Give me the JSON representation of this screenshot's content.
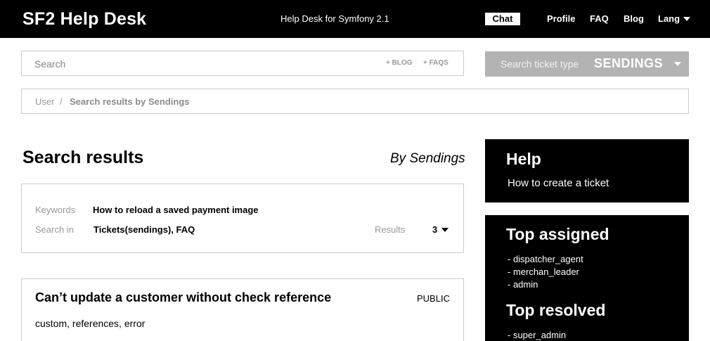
{
  "header": {
    "logo": "SF2 Help Desk",
    "tagline": "Help Desk for Symfony 2.1",
    "chat_label": "Chat",
    "nav": {
      "profile": "Profile",
      "faq": "FAQ",
      "blog": "Blog",
      "lang": "Lang"
    }
  },
  "search": {
    "placeholder": "Search",
    "blog_link": "+ BLOG",
    "faqs_link": "+ FAQS"
  },
  "ticket_type": {
    "label": "Search ticket type",
    "value": "SENDINGS"
  },
  "breadcrumb": {
    "user": "User",
    "separator": "/",
    "current": "Search results by Sendings"
  },
  "main": {
    "title": "Search results",
    "by_label": "By Sendings",
    "info": {
      "keywords_label": "Keywords",
      "keywords_value": "How to reload a saved payment image",
      "search_in_label": "Search in",
      "search_in_value": "Tickets(sendings), FAQ",
      "results_label": "Results",
      "results_value": "3"
    },
    "results": [
      {
        "title": "Can’t update a customer without check reference",
        "badge": "PUBLIC",
        "tags": "custom, references, error"
      }
    ]
  },
  "sidebar": {
    "help": {
      "title": "Help",
      "link": "How to create a ticket"
    },
    "top_assigned": {
      "title": "Top assigned",
      "items": [
        "- dispatcher_agent",
        "- merchan_leader",
        "- admin"
      ]
    },
    "top_resolved": {
      "title": "Top resolved",
      "items": [
        "- super_admin"
      ]
    }
  },
  "colors": {
    "header_bg": "#000000",
    "select_bg": "#b3b3b3",
    "border": "#cccccc",
    "muted_text": "#999999"
  }
}
